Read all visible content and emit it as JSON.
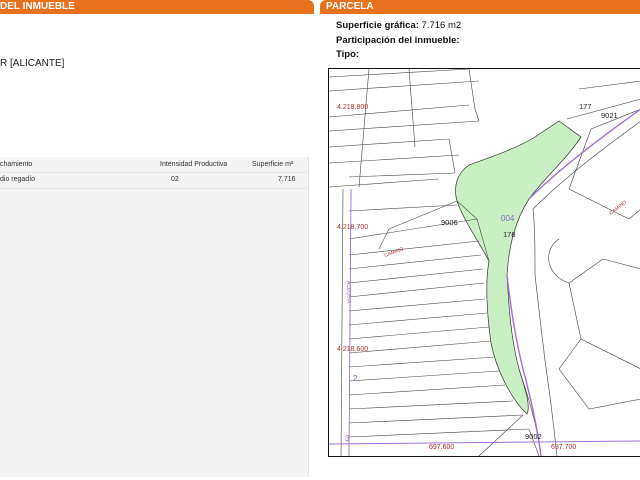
{
  "left": {
    "header": "DEL INMUEBLE",
    "location": "R [ALICANTE]",
    "table": {
      "headers": [
        "chamiento",
        "Intensidad Productiva",
        "Superficie m²"
      ],
      "row": [
        "dio regadío",
        "02",
        "7.716"
      ]
    }
  },
  "right": {
    "header": "PARCELA",
    "surface_label": "Superficie gráfica:",
    "surface_value": "7.716 m2",
    "participation_label": "Participación del inmueble:",
    "type_label": "Tipo:"
  },
  "map": {
    "coords": {
      "n800": "4.218.800",
      "n700": "4.218.700",
      "n600": "4.218.600",
      "e600": "697.600",
      "e700": "697.700"
    },
    "parcels": {
      "p177": "177",
      "p9021": "9021",
      "p9006": "9006",
      "p178": "178",
      "p9002": "9002",
      "p004": "004",
      "p2": "2",
      "p3": "3"
    },
    "roads": {
      "camino1": "CAMINO",
      "camino2": "CAMINO",
      "acequia": "ACEQUIA"
    },
    "colors": {
      "highlight": "#c9f0c3",
      "boundary": "#a070d8",
      "accent": "#e8711e"
    }
  }
}
